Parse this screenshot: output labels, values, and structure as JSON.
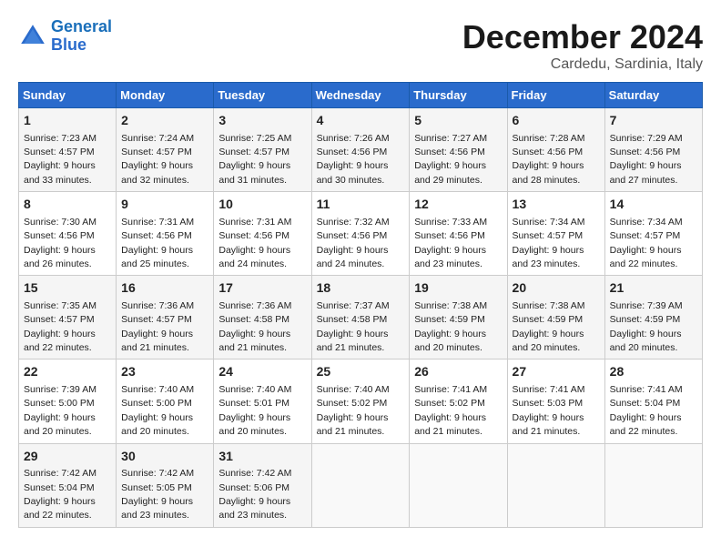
{
  "header": {
    "logo_line1": "General",
    "logo_line2": "Blue",
    "month": "December 2024",
    "location": "Cardedu, Sardinia, Italy"
  },
  "weekdays": [
    "Sunday",
    "Monday",
    "Tuesday",
    "Wednesday",
    "Thursday",
    "Friday",
    "Saturday"
  ],
  "weeks": [
    [
      {
        "day": "1",
        "sunrise": "7:23 AM",
        "sunset": "4:57 PM",
        "daylight": "9 hours and 33 minutes."
      },
      {
        "day": "2",
        "sunrise": "7:24 AM",
        "sunset": "4:57 PM",
        "daylight": "9 hours and 32 minutes."
      },
      {
        "day": "3",
        "sunrise": "7:25 AM",
        "sunset": "4:57 PM",
        "daylight": "9 hours and 31 minutes."
      },
      {
        "day": "4",
        "sunrise": "7:26 AM",
        "sunset": "4:56 PM",
        "daylight": "9 hours and 30 minutes."
      },
      {
        "day": "5",
        "sunrise": "7:27 AM",
        "sunset": "4:56 PM",
        "daylight": "9 hours and 29 minutes."
      },
      {
        "day": "6",
        "sunrise": "7:28 AM",
        "sunset": "4:56 PM",
        "daylight": "9 hours and 28 minutes."
      },
      {
        "day": "7",
        "sunrise": "7:29 AM",
        "sunset": "4:56 PM",
        "daylight": "9 hours and 27 minutes."
      }
    ],
    [
      {
        "day": "8",
        "sunrise": "7:30 AM",
        "sunset": "4:56 PM",
        "daylight": "9 hours and 26 minutes."
      },
      {
        "day": "9",
        "sunrise": "7:31 AM",
        "sunset": "4:56 PM",
        "daylight": "9 hours and 25 minutes."
      },
      {
        "day": "10",
        "sunrise": "7:31 AM",
        "sunset": "4:56 PM",
        "daylight": "9 hours and 24 minutes."
      },
      {
        "day": "11",
        "sunrise": "7:32 AM",
        "sunset": "4:56 PM",
        "daylight": "9 hours and 24 minutes."
      },
      {
        "day": "12",
        "sunrise": "7:33 AM",
        "sunset": "4:56 PM",
        "daylight": "9 hours and 23 minutes."
      },
      {
        "day": "13",
        "sunrise": "7:34 AM",
        "sunset": "4:57 PM",
        "daylight": "9 hours and 23 minutes."
      },
      {
        "day": "14",
        "sunrise": "7:34 AM",
        "sunset": "4:57 PM",
        "daylight": "9 hours and 22 minutes."
      }
    ],
    [
      {
        "day": "15",
        "sunrise": "7:35 AM",
        "sunset": "4:57 PM",
        "daylight": "9 hours and 22 minutes."
      },
      {
        "day": "16",
        "sunrise": "7:36 AM",
        "sunset": "4:57 PM",
        "daylight": "9 hours and 21 minutes."
      },
      {
        "day": "17",
        "sunrise": "7:36 AM",
        "sunset": "4:58 PM",
        "daylight": "9 hours and 21 minutes."
      },
      {
        "day": "18",
        "sunrise": "7:37 AM",
        "sunset": "4:58 PM",
        "daylight": "9 hours and 21 minutes."
      },
      {
        "day": "19",
        "sunrise": "7:38 AM",
        "sunset": "4:59 PM",
        "daylight": "9 hours and 20 minutes."
      },
      {
        "day": "20",
        "sunrise": "7:38 AM",
        "sunset": "4:59 PM",
        "daylight": "9 hours and 20 minutes."
      },
      {
        "day": "21",
        "sunrise": "7:39 AM",
        "sunset": "4:59 PM",
        "daylight": "9 hours and 20 minutes."
      }
    ],
    [
      {
        "day": "22",
        "sunrise": "7:39 AM",
        "sunset": "5:00 PM",
        "daylight": "9 hours and 20 minutes."
      },
      {
        "day": "23",
        "sunrise": "7:40 AM",
        "sunset": "5:00 PM",
        "daylight": "9 hours and 20 minutes."
      },
      {
        "day": "24",
        "sunrise": "7:40 AM",
        "sunset": "5:01 PM",
        "daylight": "9 hours and 20 minutes."
      },
      {
        "day": "25",
        "sunrise": "7:40 AM",
        "sunset": "5:02 PM",
        "daylight": "9 hours and 21 minutes."
      },
      {
        "day": "26",
        "sunrise": "7:41 AM",
        "sunset": "5:02 PM",
        "daylight": "9 hours and 21 minutes."
      },
      {
        "day": "27",
        "sunrise": "7:41 AM",
        "sunset": "5:03 PM",
        "daylight": "9 hours and 21 minutes."
      },
      {
        "day": "28",
        "sunrise": "7:41 AM",
        "sunset": "5:04 PM",
        "daylight": "9 hours and 22 minutes."
      }
    ],
    [
      {
        "day": "29",
        "sunrise": "7:42 AM",
        "sunset": "5:04 PM",
        "daylight": "9 hours and 22 minutes."
      },
      {
        "day": "30",
        "sunrise": "7:42 AM",
        "sunset": "5:05 PM",
        "daylight": "9 hours and 23 minutes."
      },
      {
        "day": "31",
        "sunrise": "7:42 AM",
        "sunset": "5:06 PM",
        "daylight": "9 hours and 23 minutes."
      },
      null,
      null,
      null,
      null
    ]
  ]
}
